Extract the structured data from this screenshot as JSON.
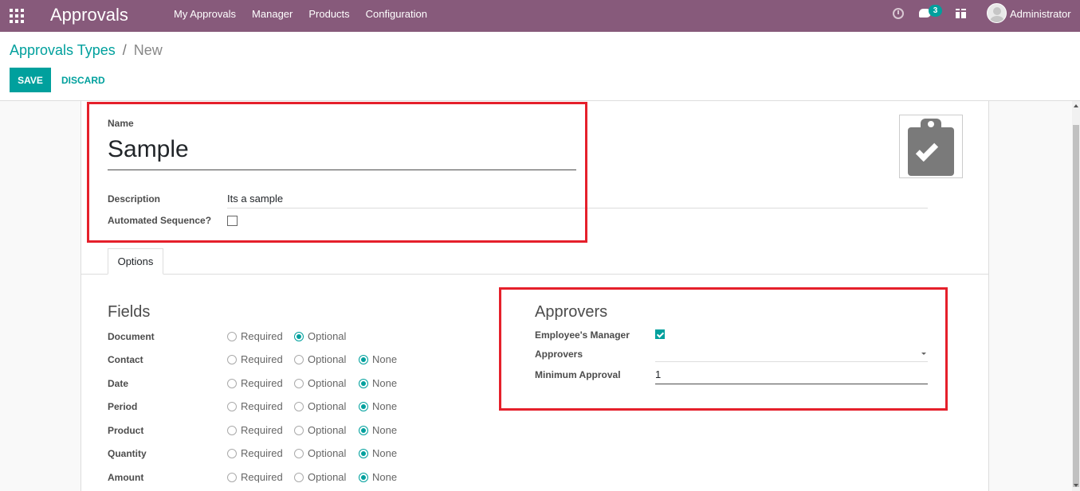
{
  "navbar": {
    "app_title": "Approvals",
    "menu": [
      "My Approvals",
      "Manager",
      "Products",
      "Configuration"
    ],
    "messages_count": "3",
    "user_name": "Administrator",
    "color": "#875a7b"
  },
  "breadcrumb": {
    "parent": "Approvals Types",
    "separator": "/",
    "current": "New"
  },
  "buttons": {
    "save": "SAVE",
    "discard": "DISCARD"
  },
  "form": {
    "name_label": "Name",
    "name_value": "Sample",
    "description_label": "Description",
    "description_value": "Its a sample",
    "automated_sequence_label": "Automated Sequence?",
    "automated_sequence_checked": false,
    "image_icon": "clipboard-check-icon"
  },
  "tabs": [
    {
      "label": "Options",
      "active": true
    }
  ],
  "fields_section": {
    "title": "Fields",
    "option_labels": {
      "required": "Required",
      "optional": "Optional",
      "none": "None"
    },
    "rows": [
      {
        "label": "Document",
        "selected": "optional",
        "has_none": false
      },
      {
        "label": "Contact",
        "selected": "none",
        "has_none": true
      },
      {
        "label": "Date",
        "selected": "none",
        "has_none": true
      },
      {
        "label": "Period",
        "selected": "none",
        "has_none": true
      },
      {
        "label": "Product",
        "selected": "none",
        "has_none": true
      },
      {
        "label": "Quantity",
        "selected": "none",
        "has_none": true
      },
      {
        "label": "Amount",
        "selected": "none",
        "has_none": true
      }
    ]
  },
  "approvers_section": {
    "title": "Approvers",
    "employees_manager_label": "Employee's Manager",
    "employees_manager_checked": true,
    "approvers_label": "Approvers",
    "approvers_value": "",
    "minimum_approval_label": "Minimum Approval",
    "minimum_approval_value": "1"
  },
  "colors": {
    "accent": "#00a09d",
    "highlight": "#e5202b"
  }
}
